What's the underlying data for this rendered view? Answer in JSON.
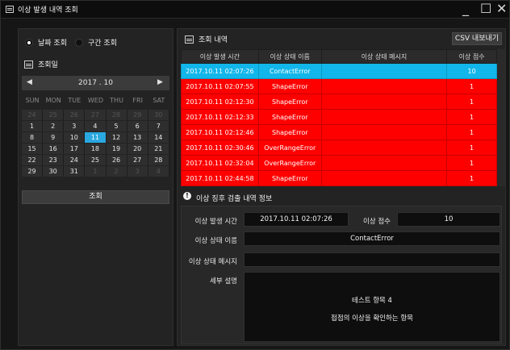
{
  "window": {
    "title": "이상 발생 내역 조회",
    "controls": {
      "minimize": "_",
      "maximize": "☐",
      "close": "✕"
    }
  },
  "left": {
    "radio_date": "날짜 조회",
    "radio_range": "구간 조회",
    "selected_radio": "날짜 조회",
    "date_section": "조회일",
    "calendar": {
      "month_label": "2017 . 10",
      "prev": "◀",
      "next": "▶",
      "weekdays": [
        "SUN",
        "MON",
        "TUE",
        "WED",
        "THU",
        "FRI",
        "SAT"
      ],
      "weeks": [
        [
          "24",
          "25",
          "26",
          "27",
          "28",
          "29",
          "30"
        ],
        [
          "1",
          "2",
          "3",
          "4",
          "5",
          "6",
          "7"
        ],
        [
          "8",
          "9",
          "10",
          "11",
          "12",
          "13",
          "14"
        ],
        [
          "15",
          "16",
          "17",
          "18",
          "19",
          "20",
          "21"
        ],
        [
          "22",
          "23",
          "24",
          "25",
          "26",
          "27",
          "28"
        ],
        [
          "29",
          "30",
          "31",
          "1",
          "2",
          "3",
          "4"
        ]
      ],
      "selected_day": "11"
    },
    "search_button": "조회"
  },
  "right": {
    "list_title": "조회 내역",
    "csv_button": "CSV 내보내기",
    "columns": [
      "이상 발생 시간",
      "이상 상태 이름",
      "이상 상태 메시지",
      "이상 점수"
    ],
    "rows": [
      [
        "2017.10.11 02:07:26",
        "ContactError",
        "",
        "10"
      ],
      [
        "2017.10.11 02:07:55",
        "ShapeError",
        "",
        "1"
      ],
      [
        "2017.10.11 02:12:30",
        "ShapeError",
        "",
        "1"
      ],
      [
        "2017.10.11 02:12:33",
        "ShapeError",
        "",
        "1"
      ],
      [
        "2017.10.11 02:12:46",
        "ShapeError",
        "",
        "1"
      ],
      [
        "2017.10.11 02:30:46",
        "OverRangeError",
        "",
        "1"
      ],
      [
        "2017.10.11 02:32:04",
        "OverRangeError",
        "",
        "1"
      ],
      [
        "2017.10.11 02:44:58",
        "ShapeError",
        "",
        "1"
      ]
    ],
    "selected_row": 0,
    "colors": {
      "error_row": "#ff0000",
      "selected_row": "#12b6ea"
    },
    "detail_title": "이상 징후 검출 내역 정보",
    "detail": {
      "time_label": "이상 발생 시간",
      "time_value": "2017.10.11 02:07:26",
      "score_label": "이상 점수",
      "score_value": "10",
      "name_label": "이상 상태 이름",
      "name_value": "ContactError",
      "message_label": "이상 상태 메시지",
      "message_value": "",
      "desc_label": "세부 설명",
      "desc_line1": "테스트 항목 4",
      "desc_line2": "접점의 이상을 확인하는 항목"
    }
  }
}
